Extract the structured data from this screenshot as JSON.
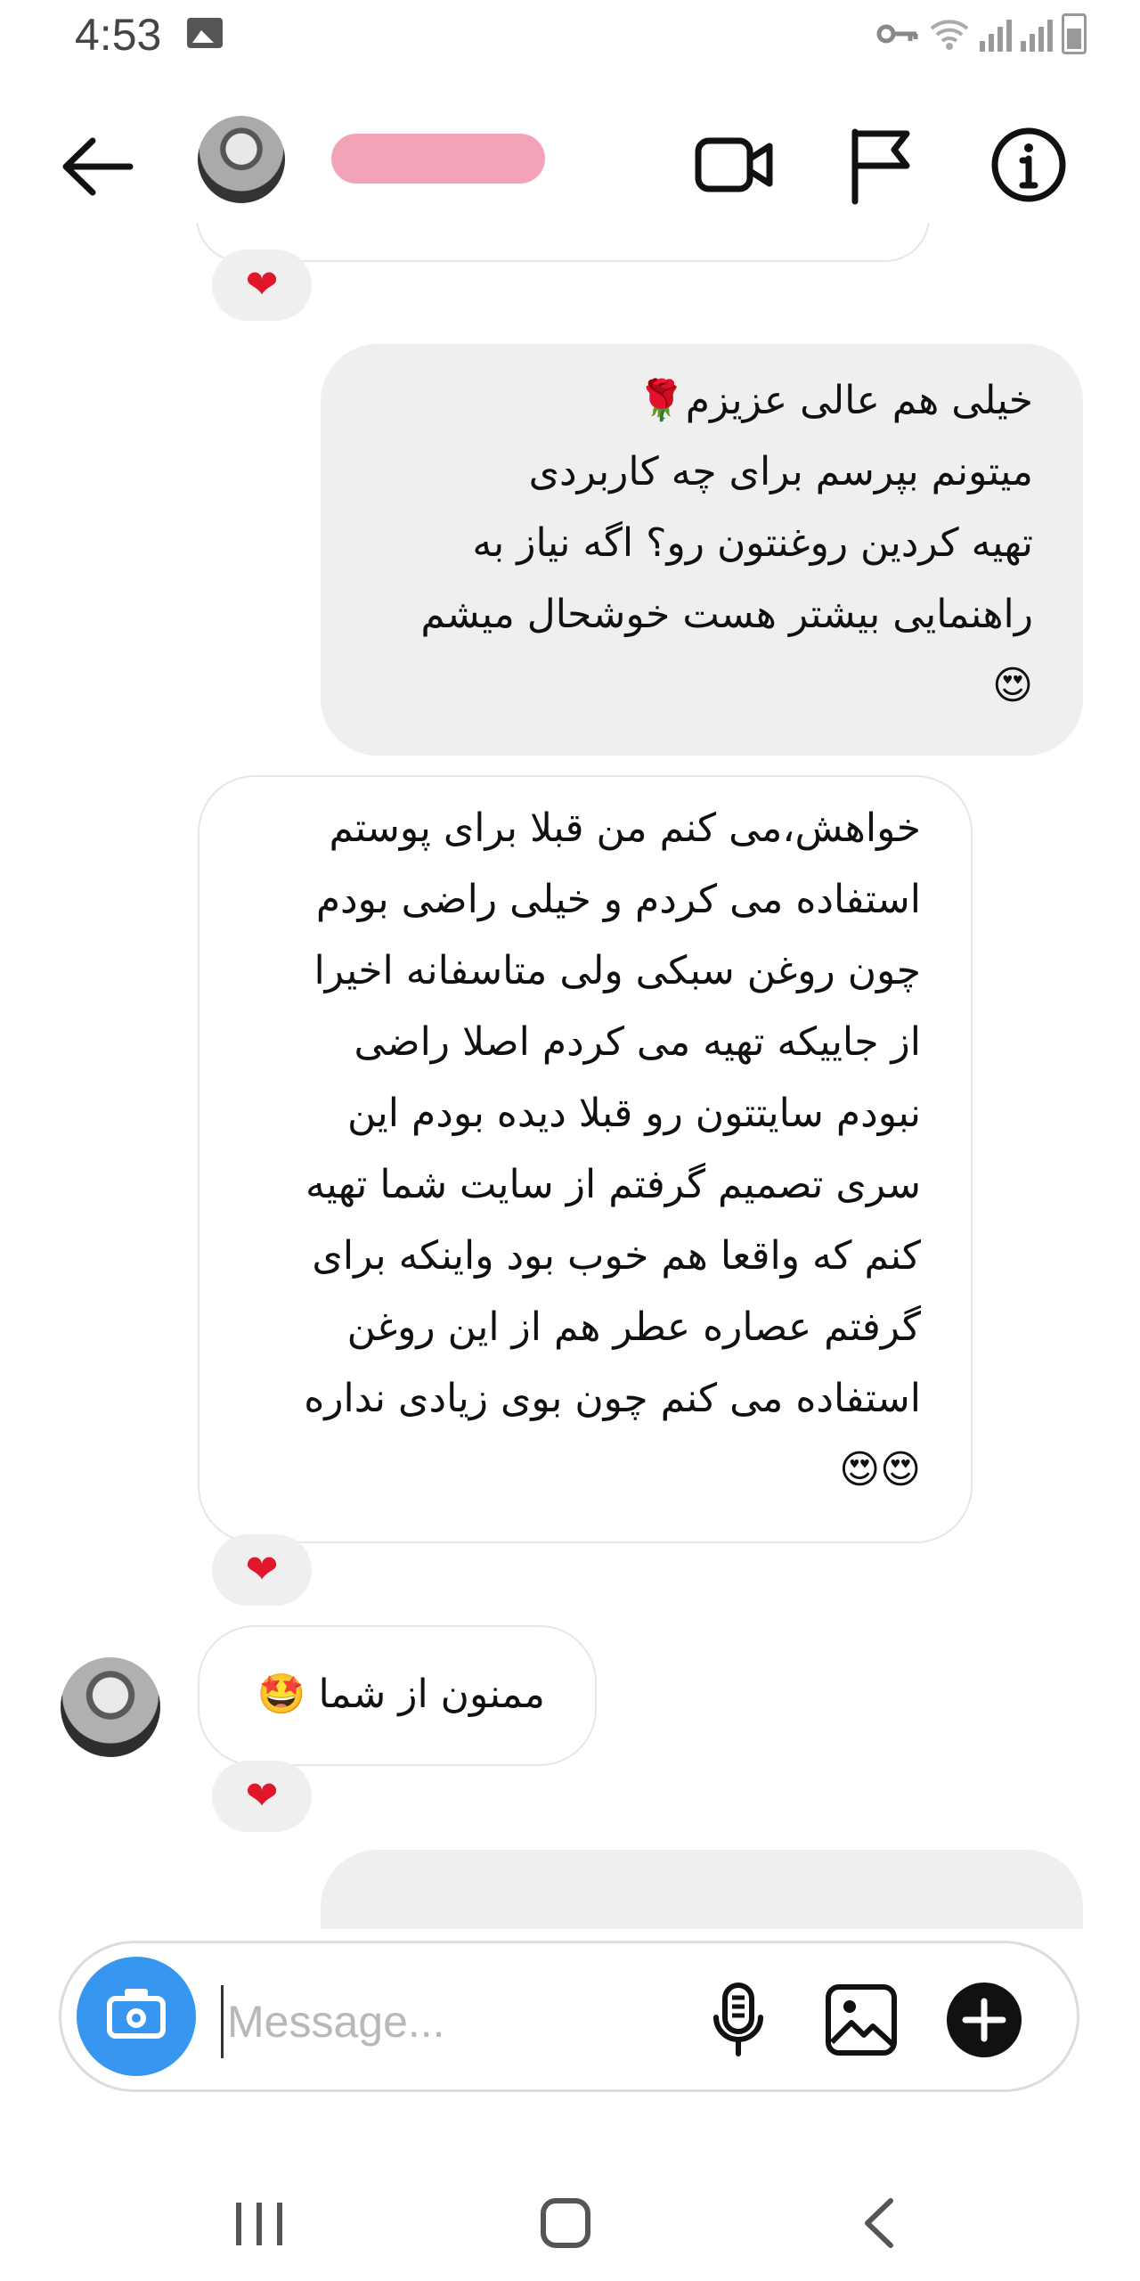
{
  "status_bar": {
    "time": "4:53",
    "left_icon": "image-notification-icon",
    "right_icons": [
      "vpn-key-icon",
      "wifi-icon",
      "signal-icon",
      "signal-icon",
      "battery-icon"
    ]
  },
  "header": {
    "username": "",
    "icons": {
      "back": "back-arrow-icon",
      "video": "video-call-icon",
      "flag": "flag-icon",
      "info": "info-icon"
    }
  },
  "messages": [
    {
      "direction": "outgoing",
      "lines": [
        "خیلی هم عالی عزیزم🌹",
        "میتونم بپرسم برای چه کاربردی",
        "تهیه کردین روغنتون رو؟ اگه نیاز به",
        "راهنمایی بیشتر هست خوشحال میشم",
        "😍"
      ]
    },
    {
      "direction": "incoming",
      "lines": [
        "خواهش،می کنم من قبلا برای پوستم",
        "استفاده می کردم و خیلی راضی بودم",
        "چون روغن سبکی ولی متاسفانه اخیرا",
        "از جاییکه تهیه می کردم اصلا راضی",
        "نبودم سایتتون رو قبلا دیده بودم این",
        "سری تصمیم گرفتم از سایت شما تهیه",
        "کنم که واقعا هم خوب بود واینکه برای",
        "گرفتم عصاره عطر هم از این روغن",
        "استفاده می کنم چون بوی زیادی نداره",
        "😍😍"
      ]
    },
    {
      "direction": "incoming",
      "text": "ممنون از شما 🤩"
    }
  ],
  "reactions": [
    "❤",
    "❤",
    "❤"
  ],
  "composer": {
    "placeholder": "Message..."
  },
  "colors": {
    "accent": "#3797f0",
    "outgoing_bubble": "#efefef",
    "heart": "#e0162b",
    "redaction": "#f2a3b8"
  }
}
